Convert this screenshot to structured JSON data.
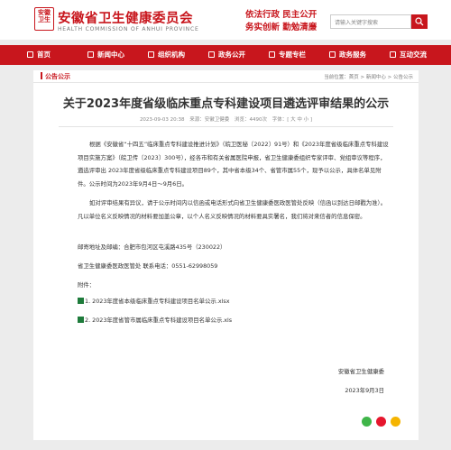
{
  "header": {
    "seal_text": [
      "安徽",
      "卫生"
    ],
    "title": "安徽省卫生健康委员会",
    "subtitle": "HEALTH COMMISSION OF ANHUI PROVINCE",
    "slogan_line1": "依法行政  民主公开",
    "slogan_line2": "务实创新  勤勉清廉",
    "search_placeholder": "请输入关键字搜索",
    "colors": {
      "brand_red": "#c8161d"
    }
  },
  "nav": {
    "items": [
      {
        "label": "首页",
        "icon": "home-icon"
      },
      {
        "label": "新闻中心",
        "icon": "news-icon"
      },
      {
        "label": "组织机构",
        "icon": "org-icon"
      },
      {
        "label": "政务公开",
        "icon": "doc-icon"
      },
      {
        "label": "专题专栏",
        "icon": "topic-icon"
      },
      {
        "label": "政务服务",
        "icon": "service-icon"
      },
      {
        "label": "互动交流",
        "icon": "chat-icon"
      }
    ]
  },
  "breadcrumb": {
    "section": "公告公示",
    "path": "当前位置：首页 > 新闻中心 > 公告公示"
  },
  "article": {
    "title": "关于2023年度省级临床重点专科建设项目遴选评审结果的公示",
    "date": "2023-09-03 20:38",
    "source": "来源：安徽卫健委",
    "views": "浏览：4490次",
    "font_size": "字体：[ 大 中 小 ]",
    "p1": "根据《安徽省“十四五”临床重点专科建设推进计划》（皖卫医秘〔2022〕91号）和《2023年度省级临床重点专科建设项目实施方案》（皖卫传〔2023〕300号），经各市和有关省属医院申报，省卫生健康委组织专家评审、党组审议等程序，遴选评审出 2023年度省级临床重点专科建设项目89个，其中省本级34个、省管市属55个，现予以公示，具体名单见附件。公示时间为2023年9月4日～9月6日。",
    "p2": "如对评审结果有异议，请于公示时间内以信函或电话形式向省卫生健康委医政医管处反映（信函以到达日邮戳为准）。凡以单位名义反映情况的材料要加盖公章，以个人名义反映情况的材料要具实署名，我们将对来信者的信息保密。",
    "address": "邮寄地址及邮编：合肥市包河区屯溪路435号（230022）",
    "contact": "省卫生健康委医政医管处      联系电话：0551-62998059",
    "attachments_label": "附件：",
    "attachments": [
      "1. 2023年度省本级临床重点专科建设项目名单公示.xlsx",
      "2. 2023年度省管市属临床重点专科建设项目名单公示.xls"
    ],
    "signature": "安徽省卫生健康委",
    "sign_date": "2023年9月3日"
  },
  "share": [
    {
      "icon": "wechat-icon",
      "color": "#3fb549"
    },
    {
      "icon": "weibo-icon",
      "color": "#e6162d"
    },
    {
      "icon": "qzone-icon",
      "color": "#f5b400"
    }
  ]
}
